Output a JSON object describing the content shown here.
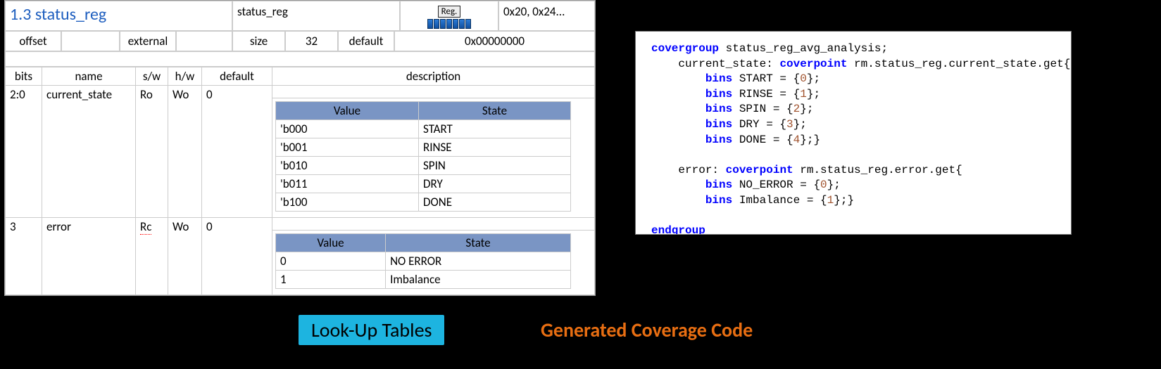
{
  "spec": {
    "section_label": "1.3 status_reg",
    "name_col": "status_reg",
    "reg_badge": "Reg.",
    "addr": "0x20, 0x24...",
    "props": {
      "offset_label": "offset",
      "offset_value": "",
      "external_label": "external",
      "external_value": "",
      "size_label": "size",
      "size_value": "32",
      "default_label": "default",
      "default_value": "0x00000000"
    },
    "columns": {
      "bits": "bits",
      "name": "name",
      "sw": "s/w",
      "hw": "h/w",
      "default": "default",
      "description": "description"
    },
    "fields": [
      {
        "bits": "2:0",
        "name": "current_state",
        "sw": "Ro",
        "hw": "Wo",
        "default": "0",
        "lookup_headers": {
          "value": "Value",
          "state": "State"
        },
        "lookup": [
          {
            "value": "'b000",
            "state": "START"
          },
          {
            "value": "'b001",
            "state": "RINSE"
          },
          {
            "value": "'b010",
            "state": "SPIN"
          },
          {
            "value": "'b011",
            "state": "DRY"
          },
          {
            "value": "'b100",
            "state": "DONE"
          }
        ]
      },
      {
        "bits": "3",
        "name": "error",
        "sw": "Rc",
        "hw": "Wo",
        "default": "0",
        "lookup_headers": {
          "value": "Value",
          "state": "State"
        },
        "lookup": [
          {
            "value": "0",
            "state": "NO ERROR"
          },
          {
            "value": "1",
            "state": "Imbalance"
          }
        ]
      }
    ]
  },
  "code": {
    "line1_a": "covergroup",
    "line1_b": " status_reg_avg_analysis;",
    "line2_a": "    current_state: ",
    "line2_kw": "coverpoint",
    "line2_b": " rm.status_reg.current_state.get{",
    "line3_a": "        ",
    "line3_kw": "bins",
    "line3_b": " START = {",
    "line3_n": "0",
    "line3_c": "};",
    "line4_a": "        ",
    "line4_kw": "bins",
    "line4_b": " RINSE = {",
    "line4_n": "1",
    "line4_c": "};",
    "line5_a": "        ",
    "line5_kw": "bins",
    "line5_b": " SPIN = {",
    "line5_n": "2",
    "line5_c": "};",
    "line6_a": "        ",
    "line6_kw": "bins",
    "line6_b": " DRY = {",
    "line6_n": "3",
    "line6_c": "};",
    "line7_a": "        ",
    "line7_kw": "bins",
    "line7_b": " DONE = {",
    "line7_n": "4",
    "line7_c": "};}",
    "blank": "",
    "line8_a": "    error: ",
    "line8_kw": "coverpoint",
    "line8_b": " rm.status_reg.error.get{",
    "line9_a": "        ",
    "line9_kw": "bins",
    "line9_b": " NO_ERROR = {",
    "line9_n": "0",
    "line9_c": "};",
    "line10_a": "        ",
    "line10_kw": "bins",
    "line10_b": " Imbalance = {",
    "line10_n": "1",
    "line10_c": "};}",
    "line11": "endgroup"
  },
  "captions": {
    "left": "Look-Up Tables",
    "right": "Generated Coverage Code"
  }
}
